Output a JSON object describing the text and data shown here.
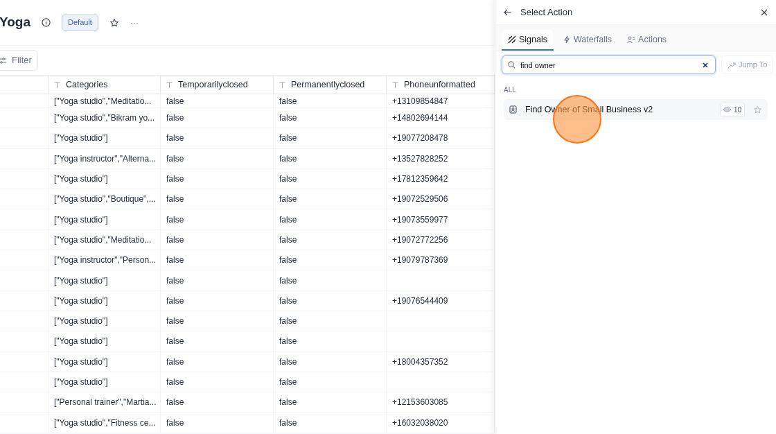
{
  "page": {
    "title": "Yoga",
    "badge": "Default",
    "more": "···",
    "filter": "Filter"
  },
  "table": {
    "columns": [
      "Categories",
      "Temporarilyclosed",
      "Permanentlyclosed",
      "Phoneunformatted"
    ],
    "rows": [
      [
        "[\"Yoga studio\",\"Meditatio...",
        "false",
        "false",
        "+13109854847"
      ],
      [
        "[\"Yoga studio\",\"Bikram yo...",
        "false",
        "false",
        "+14802694144"
      ],
      [
        "[\"Yoga studio\"]",
        "false",
        "false",
        "+19077208478"
      ],
      [
        "[\"Yoga instructor\",\"Alterna...",
        "false",
        "false",
        "+13527828252"
      ],
      [
        "[\"Yoga studio\"]",
        "false",
        "false",
        "+17812359642"
      ],
      [
        "[\"Yoga studio\",\"Boutique\",...",
        "false",
        "false",
        "+19072529506"
      ],
      [
        "[\"Yoga studio\"]",
        "false",
        "false",
        "+19073559977"
      ],
      [
        "[\"Yoga studio\",\"Meditatio...",
        "false",
        "false",
        "+19072772256"
      ],
      [
        "[\"Yoga instructor\",\"Person...",
        "false",
        "false",
        "+19079787369"
      ],
      [
        "[\"Yoga studio\"]",
        "false",
        "false",
        ""
      ],
      [
        "[\"Yoga studio\"]",
        "false",
        "false",
        "+19076544409"
      ],
      [
        "[\"Yoga studio\"]",
        "false",
        "false",
        ""
      ],
      [
        "[\"Yoga studio\"]",
        "false",
        "false",
        ""
      ],
      [
        "[\"Yoga studio\"]",
        "false",
        "false",
        "+18004357352"
      ],
      [
        "[\"Yoga studio\"]",
        "false",
        "false",
        ""
      ],
      [
        "[\"Personal trainer\",\"Martia...",
        "false",
        "false",
        "+12153603085"
      ],
      [
        "[\"Yoga studio\",\"Fitness ce...",
        "false",
        "false",
        "+16032038020"
      ]
    ]
  },
  "panel": {
    "title": "Select Action",
    "tabs": [
      {
        "label": "Signals",
        "kind": "signals",
        "selected": true
      },
      {
        "label": "Waterfalls",
        "kind": "waterfalls",
        "selected": false
      },
      {
        "label": "Actions",
        "kind": "actions",
        "selected": false
      }
    ],
    "search": {
      "value": "find owner"
    },
    "jump": {
      "label": "Jump To",
      "disabled": true
    },
    "section": "ALL",
    "results": [
      {
        "label": "Find Owner of Small Business v2",
        "credits": "10"
      }
    ]
  }
}
